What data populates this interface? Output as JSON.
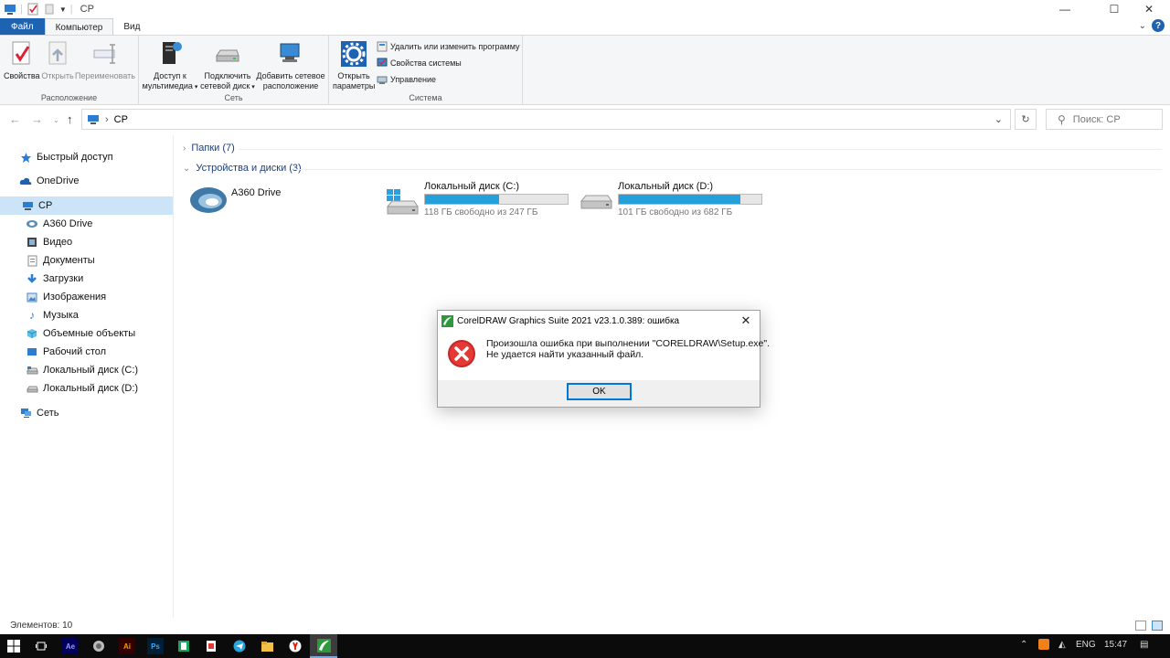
{
  "window": {
    "title": "СР",
    "controls": {
      "minimize": "—",
      "maximize": "☐",
      "close": "✕"
    }
  },
  "tabs": [
    {
      "label": "Файл"
    },
    {
      "label": "Компьютер"
    },
    {
      "label": "Вид"
    }
  ],
  "ribbon": {
    "location_group": {
      "label": "Расположение",
      "properties": "Свойства",
      "open": "Открыть",
      "rename": "Переименовать"
    },
    "network_group": {
      "label": "Сеть",
      "media_access_l1": "Доступ к",
      "media_access_l2": "мультимедиа",
      "map_drive_l1": "Подключить",
      "map_drive_l2": "сетевой диск",
      "add_location_l1": "Добавить сетевое",
      "add_location_l2": "расположение"
    },
    "system_group": {
      "label": "Система",
      "open_settings_l1": "Открыть",
      "open_settings_l2": "параметры",
      "uninstall": "Удалить или изменить программу",
      "system_props": "Свойства системы",
      "manage": "Управление"
    }
  },
  "address": {
    "path": "СР",
    "search_placeholder": "Поиск: СР"
  },
  "sidebar": {
    "items": [
      {
        "label": "Быстрый доступ",
        "icon": "star-icon"
      },
      {
        "label": "OneDrive",
        "icon": "cloud-icon"
      },
      {
        "label": "СР",
        "icon": "computer-icon"
      },
      {
        "label": "A360 Drive",
        "icon": "a360-icon"
      },
      {
        "label": "Видео",
        "icon": "video-icon"
      },
      {
        "label": "Документы",
        "icon": "documents-icon"
      },
      {
        "label": "Загрузки",
        "icon": "download-icon"
      },
      {
        "label": "Изображения",
        "icon": "pictures-icon"
      },
      {
        "label": "Музыка",
        "icon": "music-icon"
      },
      {
        "label": "Объемные объекты",
        "icon": "3d-objects-icon"
      },
      {
        "label": "Рабочий стол",
        "icon": "desktop-icon"
      },
      {
        "label": "Локальный диск (C:)",
        "icon": "drive-icon"
      },
      {
        "label": "Локальный диск (D:)",
        "icon": "drive-icon"
      },
      {
        "label": "Сеть",
        "icon": "network-icon"
      }
    ]
  },
  "content": {
    "folders_section": "Папки (7)",
    "devices_section": "Устройства и диски (3)",
    "drives": [
      {
        "name": "A360 Drive"
      },
      {
        "name": "Локальный диск (C:)",
        "free_text": "118 ГБ свободно из 247 ГБ",
        "used_fraction": 0.522
      },
      {
        "name": "Локальный диск (D:)",
        "free_text": "101 ГБ свободно из 682 ГБ",
        "used_fraction": 0.852
      }
    ]
  },
  "status": {
    "items_count": "Элементов: 10"
  },
  "dialog": {
    "title": "CorelDRAW Graphics Suite 2021 v23.1.0.389: ошибка",
    "message_line1": "Произошла ошибка при выполнении \"CORELDRAW\\Setup.exe\".",
    "message_line2": "Не удается найти указанный файл.",
    "ok_label": "OK"
  },
  "taskbar": {
    "apps": [
      {
        "name": "Ae"
      },
      {
        "name": "Ai"
      },
      {
        "name": "Ps"
      }
    ],
    "tray": {
      "language": "ENG",
      "time": "15:47"
    }
  },
  "colors": {
    "accent": "#1e62b2",
    "selection": "#cce4f7",
    "bar_fill": "#26a0da",
    "error_red": "#d32f2f"
  }
}
